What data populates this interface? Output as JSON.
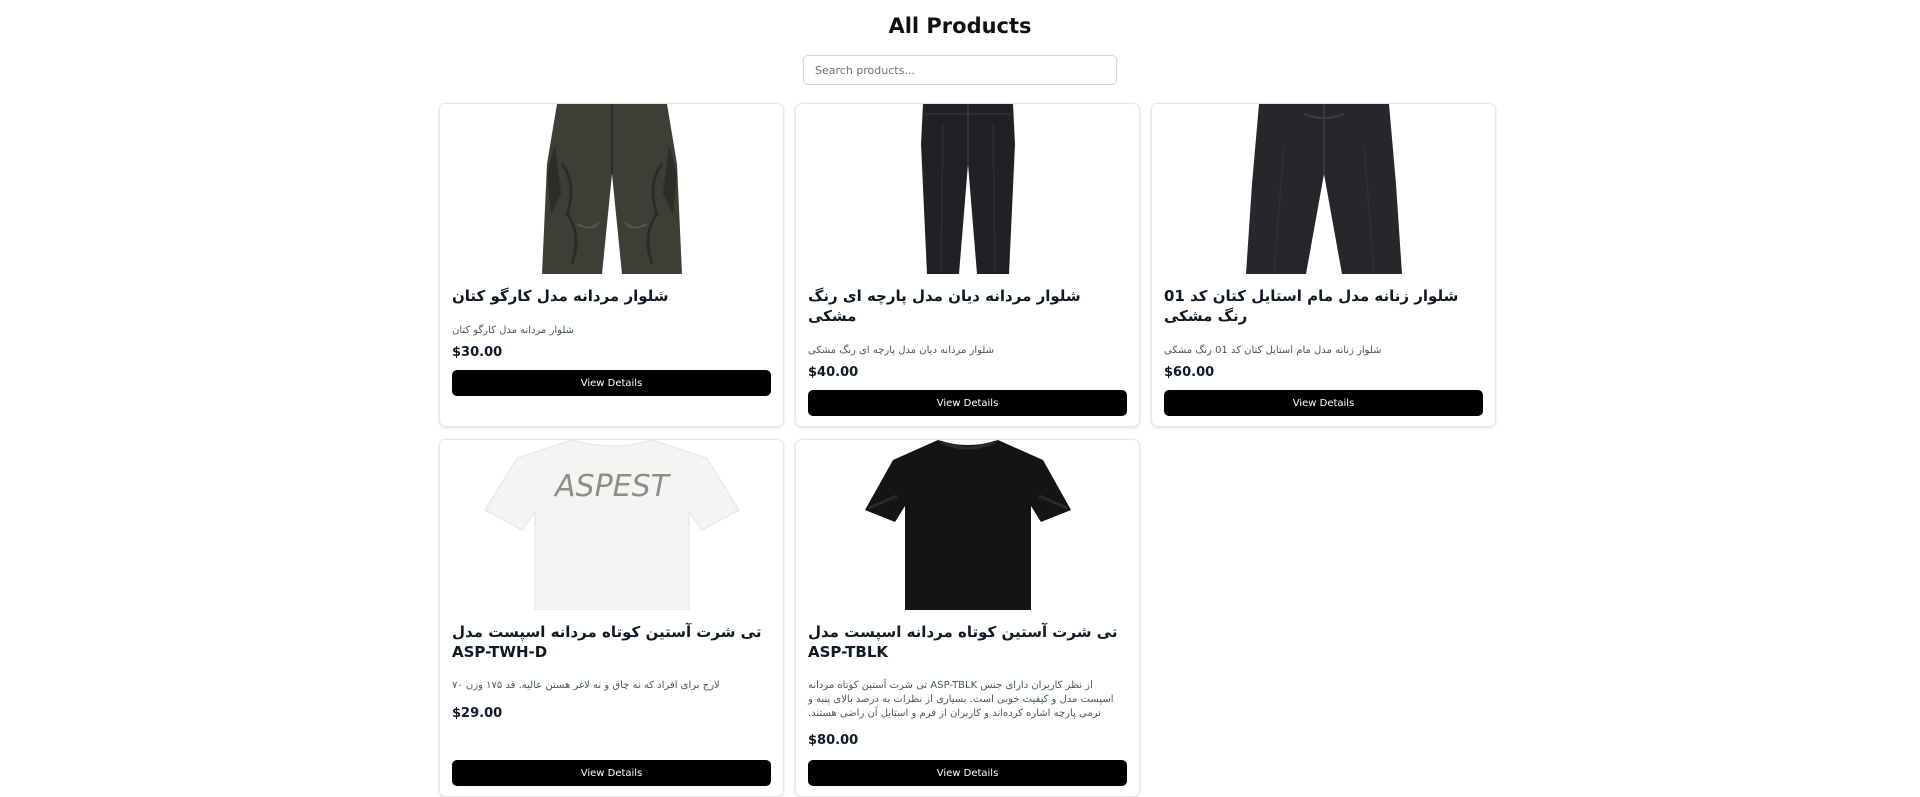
{
  "page": {
    "title": "All Products",
    "search_placeholder": "Search products..."
  },
  "products": [
    {
      "title": "شلوار مردانه مدل کارگو کتان",
      "description": "شلوار مردانه مدل کارگو کتان",
      "price": "$30.00",
      "button": "View Details",
      "image": "olive-cargo-pants"
    },
    {
      "title": "شلوار مردانه دیان مدل پارچه ای رنگ مشکی",
      "description": "شلوار مردانه دیان مدل پارچه ای رنگ مشکی",
      "price": "$40.00",
      "button": "View Details",
      "image": "black-slim-pants"
    },
    {
      "title": "شلوار زنانه مدل مام استایل کتان کد 01 رنگ مشکی",
      "description": "شلوار زنانه مدل مام استایل کتان کد 01 رنگ مشکی",
      "price": "$60.00",
      "button": "View Details",
      "image": "black-wide-pants"
    },
    {
      "title": "تی شرت آستین کوتاه مردانه اسپست مدل ASP-TWH-D",
      "description": "لارج برای افراد که نه چاق و نه لاغر هستن عالیه. قد ۱۷۵ وزن ۷۰",
      "price": "$29.00",
      "button": "View Details",
      "image": "white-aspest-tshirt",
      "image_text": "ASPEST"
    },
    {
      "title": "تی شرت آستین کوتاه مردانه اسپست مدل ASP-TBLK",
      "description": "از نظر کاربران دارای جنس ASP-TBLK تی شرت آستین کوتاه مردانه اسپست مدل و کیفیت خوبی است. بسیاری از نظرات به درصد بالای پنبه و نرمی پارچه اشاره کرده‌اند و کاربران از فرم و استایل آن راضی هستند.",
      "price": "$80.00",
      "button": "View Details",
      "image": "black-tshirt"
    }
  ],
  "colors": {
    "button_bg": "#000000",
    "button_text": "#ffffff",
    "card_border": "#e5e7eb"
  }
}
